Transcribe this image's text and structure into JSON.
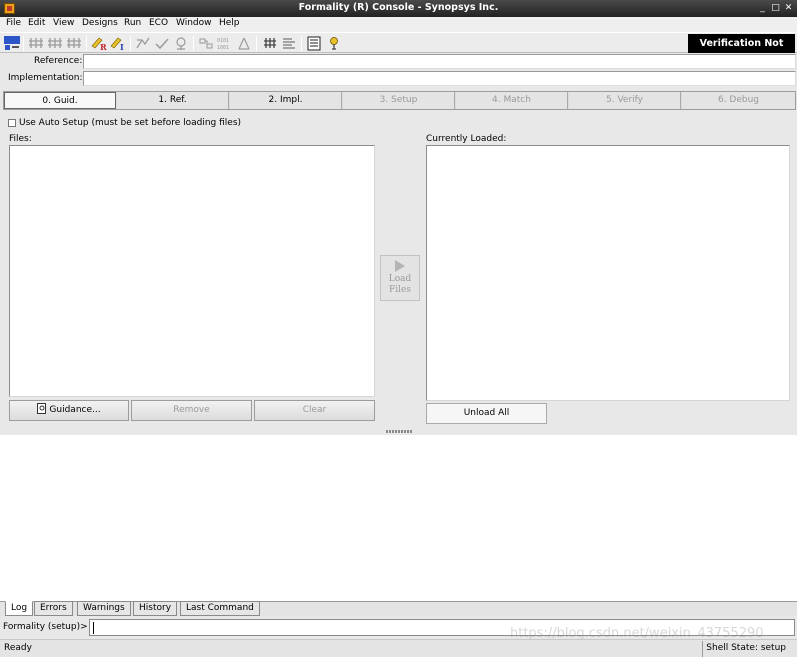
{
  "window": {
    "title": "Formality (R) Console - Synopsys Inc."
  },
  "menu": [
    "File",
    "Edit",
    "View",
    "Designs",
    "Run",
    "ECO",
    "Window",
    "Help"
  ],
  "toolbar": {
    "status_badge": "Verification Not Run"
  },
  "reference": {
    "label": "Reference:",
    "value": ""
  },
  "implementation": {
    "label": "Implementation:",
    "value": ""
  },
  "tabs": [
    "0. Guid.",
    "1. Ref.",
    "2. Impl.",
    "3. Setup",
    "4. Match",
    "5. Verify",
    "6. Debug"
  ],
  "auto_setup": {
    "label": "Use Auto Setup (must be set before loading files)",
    "checked": false
  },
  "files_panel": {
    "label": "Files:"
  },
  "loaded_panel": {
    "label": "Currently Loaded:"
  },
  "buttons": {
    "guidance": "Guidance...",
    "remove": "Remove",
    "clear": "Clear",
    "load_files_line1": "Load",
    "load_files_line2": "Files",
    "unload_all": "Unload All"
  },
  "bottom_tabs": [
    "Log",
    "Errors",
    "Warnings",
    "History",
    "Last Command"
  ],
  "command": {
    "prompt": "Formality (setup)>",
    "value": ""
  },
  "status": {
    "left": "Ready",
    "right": "Shell State: setup"
  },
  "watermark": "https://blog.csdn.net/weixin_43755290"
}
